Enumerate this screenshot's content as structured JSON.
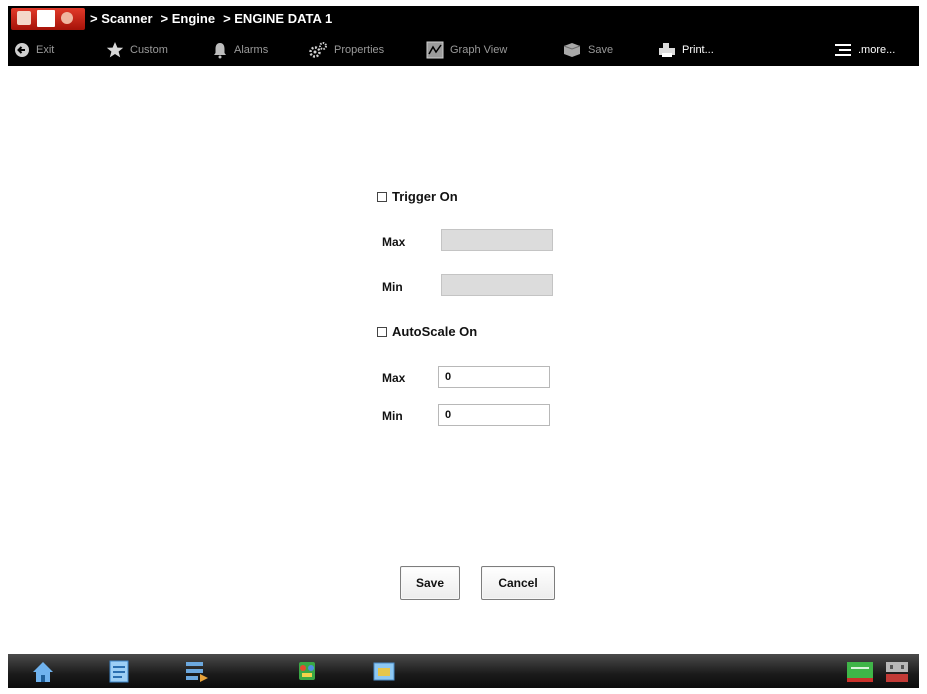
{
  "breadcrumb": [
    "> Scanner",
    "> Engine",
    "> ENGINE DATA 1"
  ],
  "toolbar": {
    "exit": "Exit",
    "custom": "Custom",
    "alarms": "Alarms",
    "properties": "Properties",
    "graph_view": "Graph View",
    "save": "Save",
    "print": "Print...",
    "more": ".more..."
  },
  "form": {
    "trigger_label": "Trigger On",
    "trigger_checked": false,
    "trigger_max_label": "Max",
    "trigger_max_value": "",
    "trigger_min_label": "Min",
    "trigger_min_value": "",
    "autoscale_label": "AutoScale On",
    "autoscale_checked": false,
    "scale_max_label": "Max",
    "scale_max_value": "0",
    "scale_min_label": "Min",
    "scale_min_value": "0",
    "save_label": "Save",
    "cancel_label": "Cancel"
  },
  "icons": {
    "exit": "back-arrow-icon",
    "custom": "star-icon",
    "alarms": "bell-icon",
    "properties": "gears-icon",
    "graph_view": "graph-icon",
    "save": "save-icon",
    "print": "printer-icon",
    "more": "list-menu-icon",
    "taskbar": [
      "home-icon",
      "notepad-icon",
      "tools-icon",
      "scanner-icon",
      "folder-icon",
      "status-indicator-icon",
      "usb-icon"
    ]
  },
  "colors": {
    "header_bg": "#000000",
    "toolbar_text_dim": "#9a9a9a",
    "toolbar_text_bright": "#ffffff",
    "logo_red": "#d42a1c",
    "field_disabled": "#dcdcdc"
  }
}
